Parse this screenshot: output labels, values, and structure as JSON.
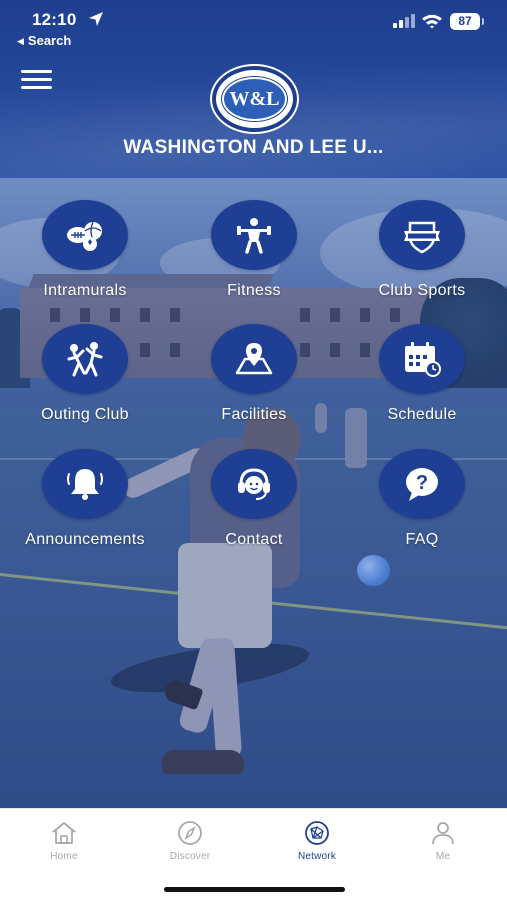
{
  "status_bar": {
    "time": "12:10",
    "back_label": "Search",
    "battery": "87"
  },
  "header": {
    "logo_text": "W&L",
    "title": "WASHINGTON AND LEE U..."
  },
  "colors": {
    "primary": "#1f3f94",
    "tab_inactive": "#a8a8a8",
    "header": "#274a9c"
  },
  "tiles": [
    {
      "label": "Intramurals",
      "icon": "sports-balls-icon"
    },
    {
      "label": "Fitness",
      "icon": "weightlifter-icon"
    },
    {
      "label": "Club Sports",
      "icon": "shield-banner-icon"
    },
    {
      "label": "Outing Club",
      "icon": "outing-people-icon"
    },
    {
      "label": "Facilities",
      "icon": "map-pin-icon"
    },
    {
      "label": "Schedule",
      "icon": "calendar-clock-icon"
    },
    {
      "label": "Announcements",
      "icon": "bell-icon"
    },
    {
      "label": "Contact",
      "icon": "headset-icon"
    },
    {
      "label": "FAQ",
      "icon": "question-bubble-icon"
    }
  ],
  "tabbar": {
    "items": [
      {
        "label": "Home",
        "icon": "home-icon"
      },
      {
        "label": "Discover",
        "icon": "compass-icon"
      },
      {
        "label": "Network",
        "icon": "network-icon",
        "active": true
      },
      {
        "label": "Me",
        "icon": "person-icon"
      }
    ]
  }
}
